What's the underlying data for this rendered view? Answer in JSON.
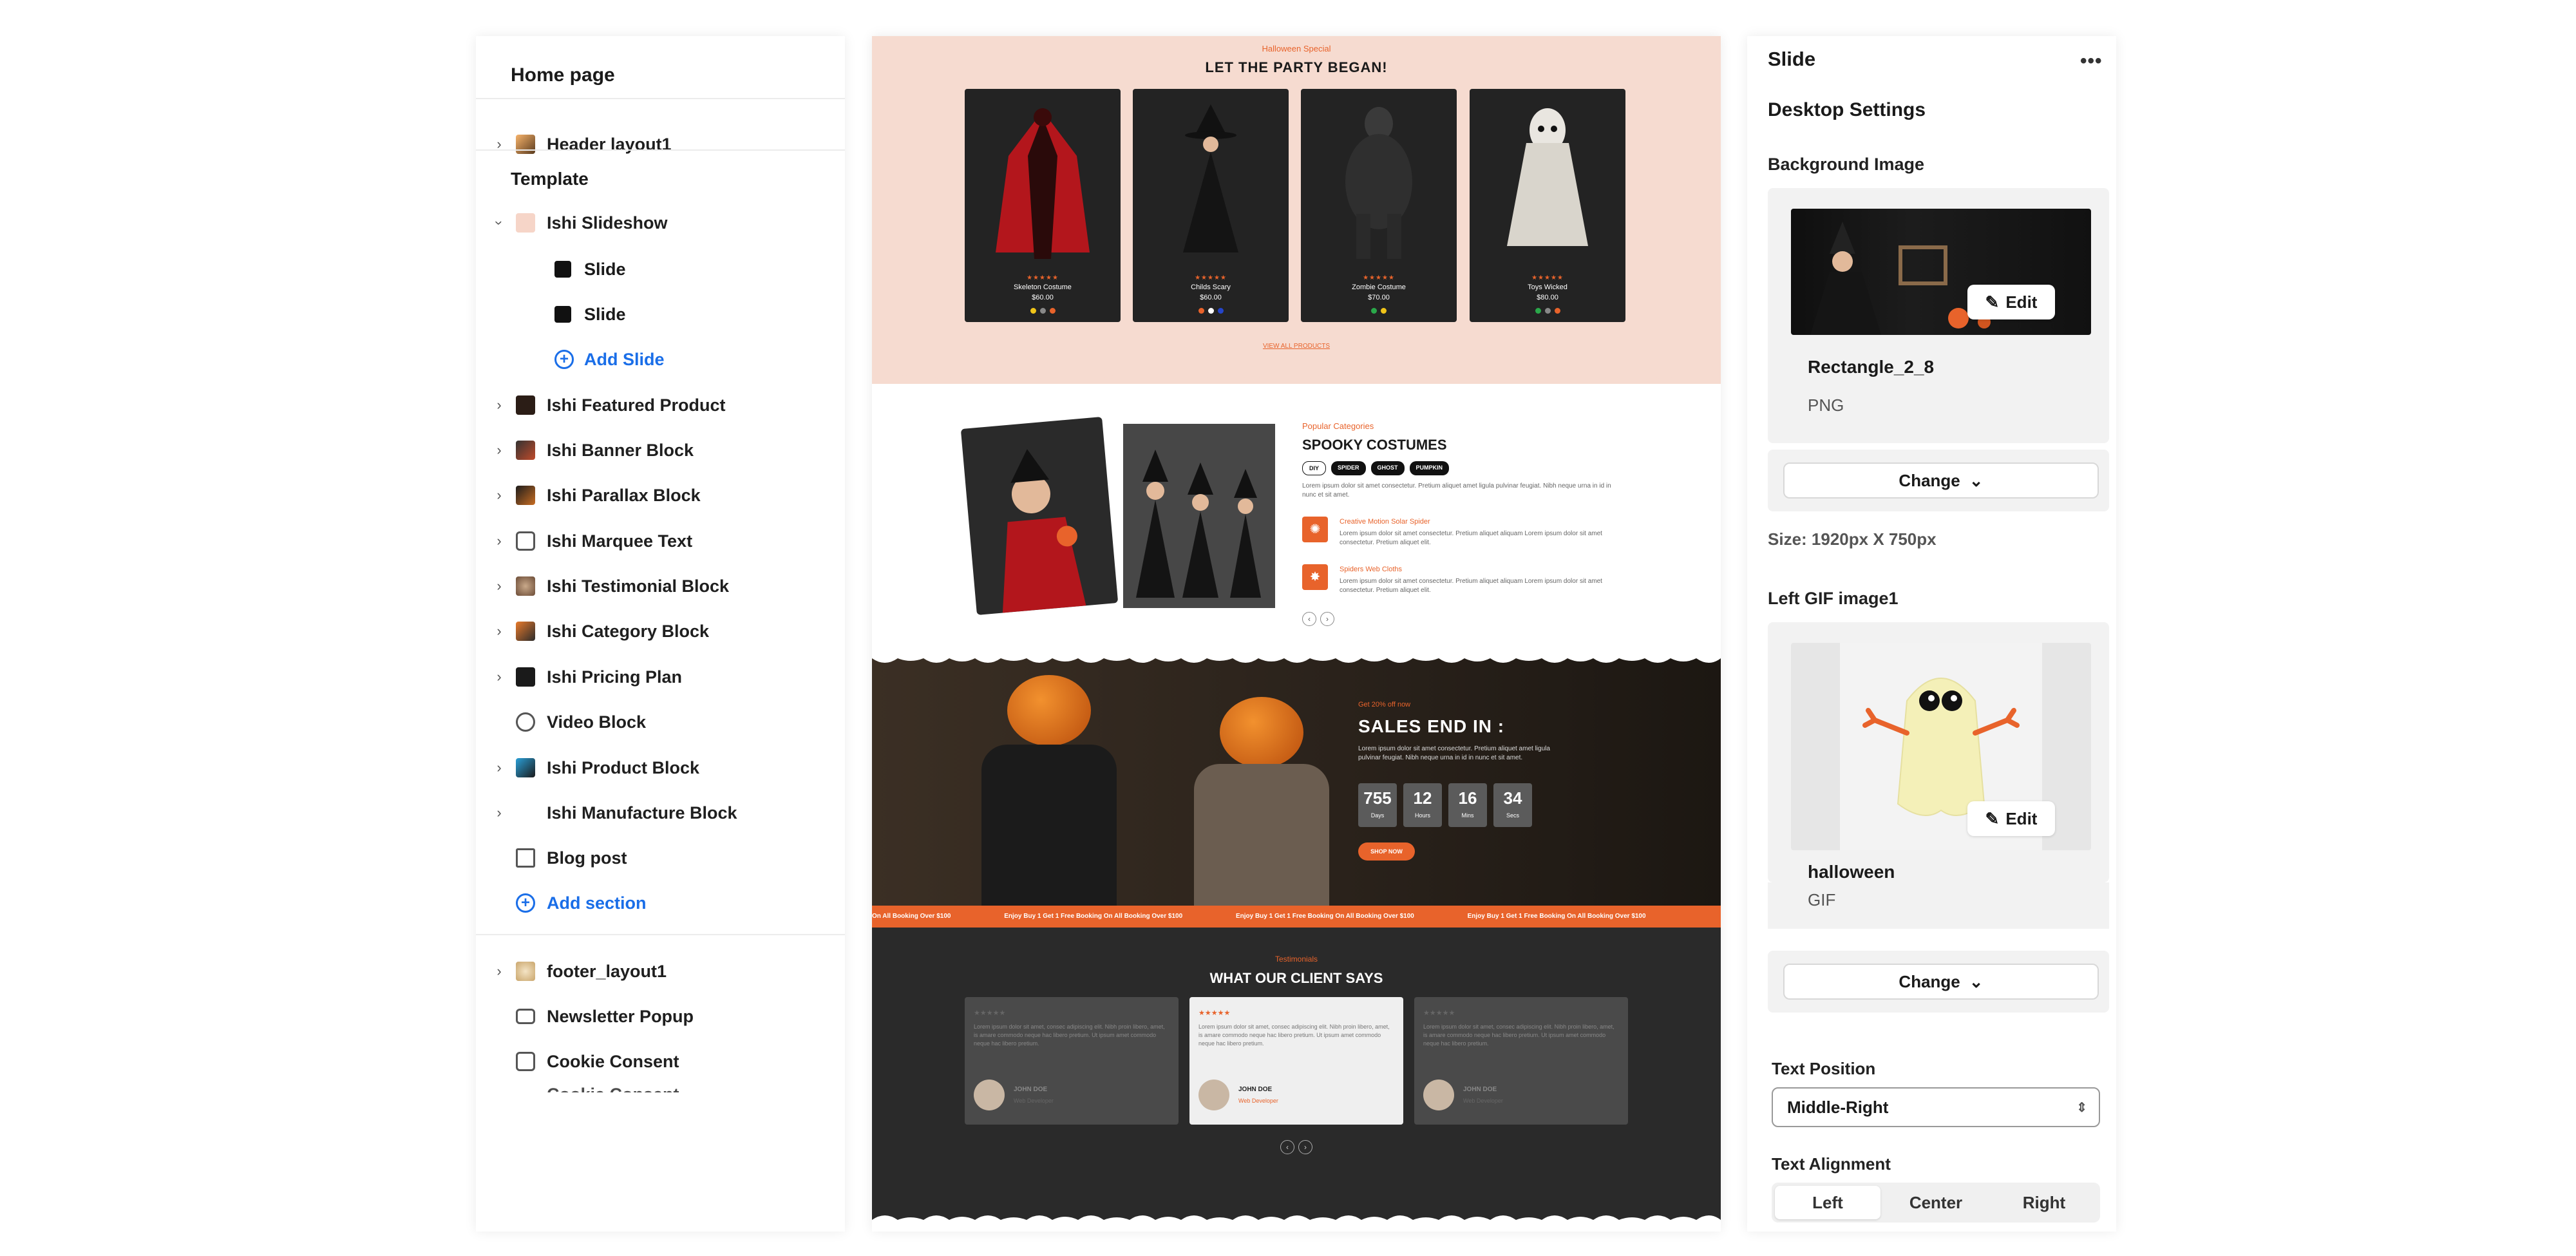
{
  "left_panel": {
    "title": "Home page",
    "header_item": "Header layout1",
    "template_label": "Template",
    "slideshow": "Ishi Slideshow",
    "slides": [
      "Slide",
      "Slide"
    ],
    "add_slide": "Add Slide",
    "sections": [
      "Ishi Featured Product",
      "Ishi Banner Block",
      "Ishi Parallax Block",
      "Ishi Marquee Text",
      "Ishi Testimonial Block",
      "Ishi Category Block",
      "Ishi Pricing Plan",
      "Video Block",
      "Ishi Product Block",
      "Ishi Manufacture Block",
      "Blog post"
    ],
    "add_section": "Add section",
    "footer_item": "footer_layout1",
    "newsletter": "Newsletter Popup",
    "cookie": "Cookie Consent",
    "cookie_cut": "Cookie Consent"
  },
  "preview": {
    "sec1": {
      "kicker": "Halloween Special",
      "title": "LET THE PARTY BEGAN!",
      "products": [
        {
          "name": "Skeleton Costume",
          "price": "$60.00",
          "stars": "★★★★★",
          "dots": [
            "#f0c419",
            "#888888",
            "#e8632b"
          ]
        },
        {
          "name": "Childs Scary",
          "price": "$60.00",
          "stars": "★★★★★",
          "dots": [
            "#e8632b",
            "#ffffff",
            "#2545c9"
          ]
        },
        {
          "name": "Zombie Costume",
          "price": "$70.00",
          "stars": "★★★★★",
          "dots": [
            "#2aa84a",
            "#f0c419"
          ]
        },
        {
          "name": "Toys Wicked",
          "price": "$80.00",
          "stars": "★★★★★",
          "dots": [
            "#2aa84a",
            "#888888",
            "#e8632b"
          ]
        }
      ],
      "link": "VIEW ALL PRODUCTS"
    },
    "sec2": {
      "kicker": "Popular Categories",
      "title": "SPOOKY COSTUMES",
      "tags": [
        "DIY",
        "SPIDER",
        "GHOST",
        "PUMPKIN"
      ],
      "para": "Lorem ipsum dolor sit amet consectetur. Pretium aliquet amet ligula pulvinar feugiat. Nibh neque urna in id in nunc et sit amet.",
      "features": [
        {
          "title": "Creative Motion Solar Spider",
          "text": "Lorem ipsum dolor sit amet consectetur. Pretium aliquet aliquam Lorem ipsum dolor sit amet consectetur. Pretium aliquet elit."
        },
        {
          "title": "Spiders Web Cloths",
          "text": "Lorem ipsum dolor sit amet consectetur. Pretium aliquet aliquam Lorem ipsum dolor sit amet consectetur. Pretium aliquet elit."
        }
      ]
    },
    "sec3": {
      "kicker": "Get 20% off now",
      "title": "SALES END IN :",
      "para": "Lorem ipsum dolor sit amet consectetur. Pretium aliquet amet ligula pulvinar feugiat. Nibh neque urna in id in nunc et sit amet.",
      "countdown": [
        {
          "num": "755",
          "lbl": "Days"
        },
        {
          "num": "12",
          "lbl": "Hours"
        },
        {
          "num": "16",
          "lbl": "Mins"
        },
        {
          "num": "34",
          "lbl": "Secs"
        }
      ],
      "button": "SHOP NOW"
    },
    "marquee": [
      "On All Booking Over $100",
      "Enjoy Buy 1 Get 1 Free Booking On All Booking Over $100",
      "Enjoy Buy 1 Get 1 Free Booking On All Booking Over $100",
      "Enjoy Buy 1 Get 1 Free Booking On All Booking Over $100"
    ],
    "sec4": {
      "kicker": "Testimonials",
      "title": "WHAT OUR CLIENT SAYS",
      "cards": [
        {
          "stars": "★★★★★",
          "text": "Lorem ipsum dolor sit amet, consec adipiscing elit. Nibh proin libero, amet, is amare commodo neque hac libero pretium. Ut ipsum amet commodo neque hac libero pretium.",
          "name": "JOHN DOE",
          "role": "Web Developer"
        },
        {
          "stars": "★★★★★",
          "text": "Lorem ipsum dolor sit amet, consec adipiscing elit. Nibh proin libero, amet, is amare commodo neque hac libero pretium. Ut ipsum amet commodo neque hac libero pretium.",
          "name": "JOHN DOE",
          "role": "Web Developer"
        },
        {
          "stars": "★★★★★",
          "text": "Lorem ipsum dolor sit amet, consec adipiscing elit. Nibh proin libero, amet, is amare commodo neque hac libero pretium. Ut ipsum amet commodo neque hac libero pretium.",
          "name": "JOHN DOE",
          "role": "Web Developer"
        }
      ]
    }
  },
  "right_panel": {
    "title": "Slide",
    "more": "•••",
    "subtitle": "Desktop Settings",
    "bg_label": "Background Image",
    "bg_file": "Rectangle_2_8",
    "bg_type": "PNG",
    "edit": "Edit",
    "change": "Change",
    "size": "Size: 1920px X 750px",
    "gif_label": "Left GIF image1",
    "gif_file": "halloween",
    "gif_type": "GIF",
    "text_position_label": "Text Position",
    "text_position_value": "Middle-Right",
    "text_alignment_label": "Text Alignment",
    "alignment_options": [
      "Left",
      "Center",
      "Right"
    ],
    "alignment_selected": "Left"
  }
}
